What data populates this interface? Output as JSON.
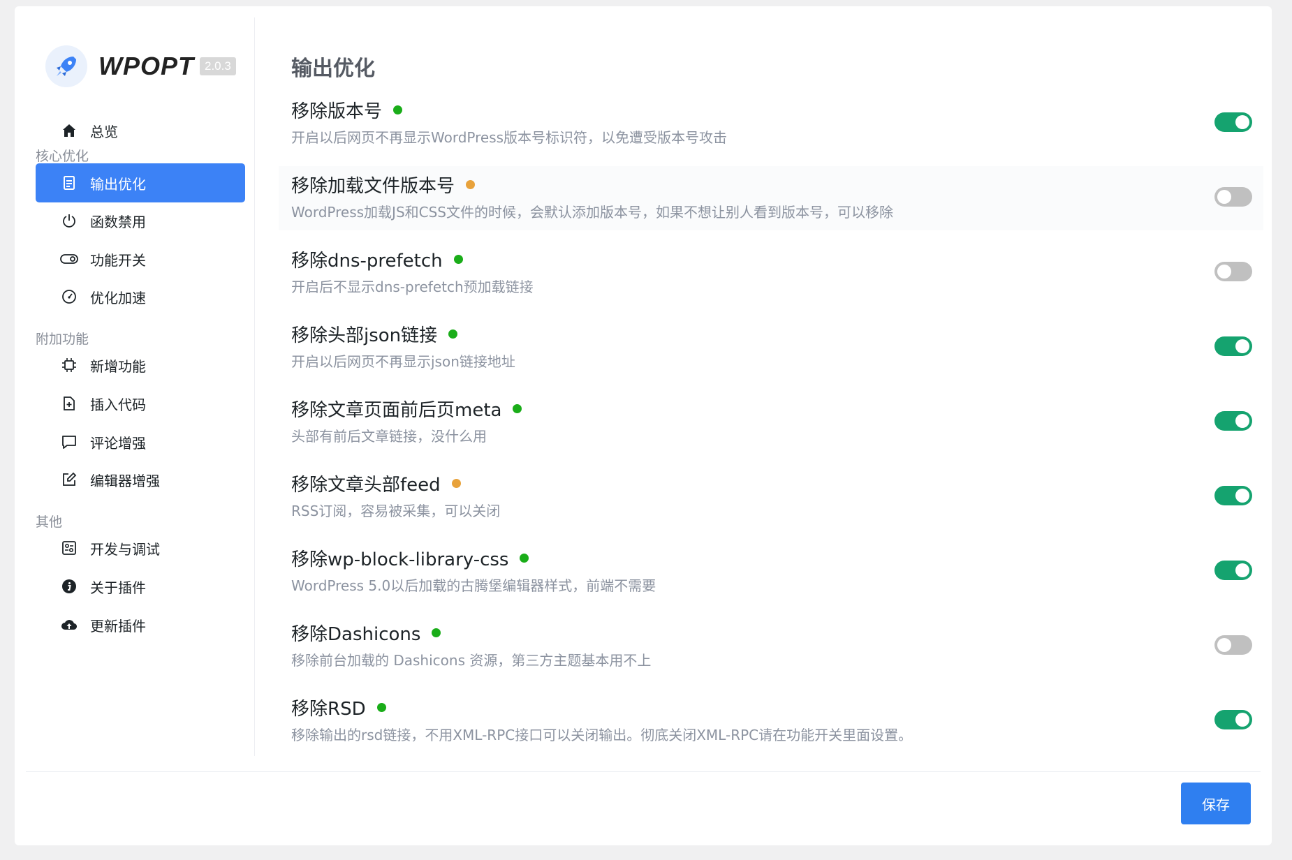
{
  "brand": {
    "name": "WPOPT",
    "version": "2.0.3"
  },
  "sidebar": {
    "overview": "总览",
    "group_core": "核心优化",
    "output_opt": "输出优化",
    "func_disable": "函数禁用",
    "feature_switch": "功能开关",
    "speed_up": "优化加速",
    "group_extra": "附加功能",
    "new_features": "新增功能",
    "insert_code": "插入代码",
    "comment_enhance": "评论增强",
    "editor_enhance": "编辑器增强",
    "group_other": "其他",
    "dev_debug": "开发与调试",
    "about": "关于插件",
    "update": "更新插件"
  },
  "main": {
    "title": "输出优化",
    "options": [
      {
        "title": "移除版本号",
        "desc": "开启以后网页不再显示WordPress版本号标识符，以免遭受版本号攻击",
        "status": "green",
        "enabled": true
      },
      {
        "title": "移除加载文件版本号",
        "desc": "WordPress加载JS和CSS文件的时候，会默认添加版本号，如果不想让别人看到版本号，可以移除",
        "status": "orange",
        "enabled": false
      },
      {
        "title": "移除dns-prefetch",
        "desc": "开启后不显示dns-prefetch预加载链接",
        "status": "green",
        "enabled": false
      },
      {
        "title": "移除头部json链接",
        "desc": "开启以后网页不再显示json链接地址",
        "status": "green",
        "enabled": true
      },
      {
        "title": "移除文章页面前后页meta",
        "desc": "头部有前后文章链接，没什么用",
        "status": "green",
        "enabled": true
      },
      {
        "title": "移除文章头部feed",
        "desc": "RSS订阅，容易被采集，可以关闭",
        "status": "orange",
        "enabled": true
      },
      {
        "title": "移除wp-block-library-css",
        "desc": "WordPress 5.0以后加载的古腾堡编辑器样式，前端不需要",
        "status": "green",
        "enabled": true
      },
      {
        "title": "移除Dashicons",
        "desc": "移除前台加载的 Dashicons 资源，第三方主题基本用不上",
        "status": "green",
        "enabled": false
      },
      {
        "title": "移除RSD",
        "desc": "移除输出的rsd链接，不用XML-RPC接口可以关闭输出。彻底关闭XML-RPC请在功能开关里面设置。",
        "status": "green",
        "enabled": true
      }
    ]
  },
  "footer": {
    "save_label": "保存"
  },
  "colors": {
    "accent": "#3c82f6",
    "toggle_on": "#15a36f",
    "dot_green": "#1aad19",
    "dot_orange": "#e8a23b"
  }
}
